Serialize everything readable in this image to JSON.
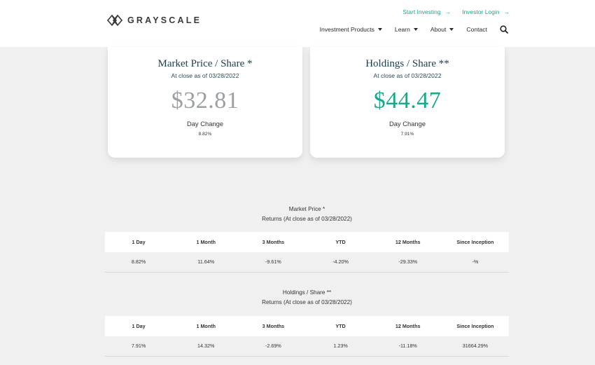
{
  "header": {
    "logo_text": "GRAYSCALE",
    "top_links": [
      {
        "label": "Start Investing"
      },
      {
        "label": "Investor Login"
      }
    ],
    "nav": [
      {
        "label": "Investment Products",
        "has_dropdown": true
      },
      {
        "label": "Learn",
        "has_dropdown": true
      },
      {
        "label": "About",
        "has_dropdown": true
      },
      {
        "label": "Contact",
        "has_dropdown": false
      }
    ],
    "search_icon": "search-icon",
    "accent_color": "#1aa88a"
  },
  "market_card": {
    "title": "Market Price / Share *",
    "subtitle": "At close as of 03/28/2022",
    "price": "$32.81",
    "change_label": "Day Change",
    "change_value": "8.82%"
  },
  "holdings_card": {
    "title": "Holdings / Share **",
    "subtitle": "At close as of 03/28/2022",
    "price": "$44.47",
    "change_label": "Day Change",
    "change_value": "7.91%"
  },
  "market_returns": {
    "title": "Market Price *",
    "subtitle": "Returns (At close as of 03/28/2022)",
    "headers": [
      "1 Day",
      "1 Month",
      "3 Months",
      "YTD",
      "12 Months",
      "Since Inception"
    ],
    "values": [
      "8.82%",
      "11.64%",
      "-9.61%",
      "-4.20%",
      "-29.33%",
      "-%"
    ]
  },
  "holdings_returns": {
    "title": "Holdings / Share **",
    "subtitle": "Returns (At close as of 03/28/2022)",
    "headers": [
      "1 Day",
      "1 Month",
      "3 Months",
      "YTD",
      "12 Months",
      "Since Inception"
    ],
    "values": [
      "7.91%",
      "14.32%",
      "-2.69%",
      "1.23%",
      "-11.18%",
      "31664.29%"
    ]
  }
}
